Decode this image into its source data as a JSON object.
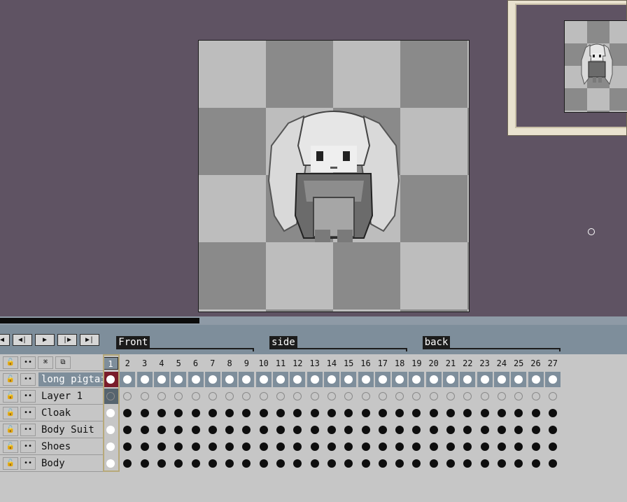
{
  "timeline": {
    "playback_buttons": [
      {
        "name": "first-frame",
        "glyph": "|◀"
      },
      {
        "name": "prev-frame",
        "glyph": "◀|"
      },
      {
        "name": "play",
        "glyph": "▶"
      },
      {
        "name": "next-frame",
        "glyph": "|▶"
      },
      {
        "name": "last-frame",
        "glyph": "▶|"
      }
    ],
    "tags": [
      {
        "label": "Front",
        "start": 2,
        "end": 9
      },
      {
        "label": "side",
        "start": 11,
        "end": 18
      },
      {
        "label": "back",
        "start": 20,
        "end": 27
      }
    ],
    "header_icons": [
      "lock-icon",
      "eye-icon",
      "link-icon",
      "continuous-icon"
    ],
    "current_frame": "1",
    "frames": [
      "1",
      "2",
      "3",
      "4",
      "5",
      "6",
      "7",
      "8",
      "9",
      "10",
      "11",
      "12",
      "13",
      "14",
      "15",
      "16",
      "17",
      "18",
      "19",
      "20",
      "21",
      "22",
      "23",
      "24",
      "25",
      "26",
      "27"
    ],
    "layers": [
      {
        "name": "long pigtails",
        "selected": true,
        "cels": "white"
      },
      {
        "name": "Layer 1",
        "selected": false,
        "cels": "empty"
      },
      {
        "name": "Cloak",
        "selected": false,
        "cels": "full"
      },
      {
        "name": "Body Suit",
        "selected": false,
        "cels": "full"
      },
      {
        "name": "Shoes",
        "selected": false,
        "cels": "full"
      },
      {
        "name": "Body",
        "selected": false,
        "cels": "full"
      }
    ],
    "layer_icon_glyphs": {
      "lock": "🔓",
      "eye": "••"
    }
  },
  "colors": {
    "workspace": "#5f5363",
    "panel": "#c6c6c6",
    "accent": "#7e8e9b",
    "selected_cel": "#7a1c2a"
  }
}
